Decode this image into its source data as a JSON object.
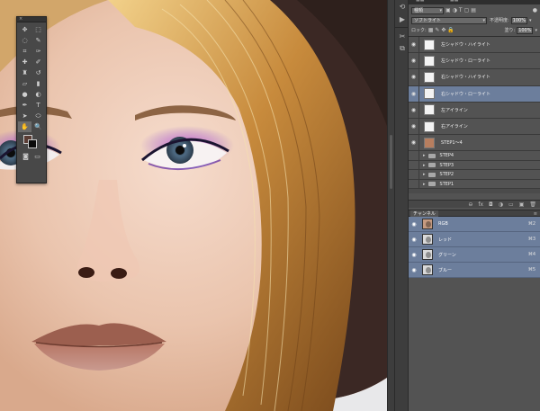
{
  "tools_panel": {
    "close_glyph": "×",
    "tools": [
      {
        "name": "move-icon",
        "glyph": "✥"
      },
      {
        "name": "marquee-icon",
        "glyph": "⬚"
      },
      {
        "name": "lasso-icon",
        "glyph": "◌"
      },
      {
        "name": "quick-select-icon",
        "glyph": "✎"
      },
      {
        "name": "crop-icon",
        "glyph": "⌗"
      },
      {
        "name": "eyedropper-icon",
        "glyph": "✑"
      },
      {
        "name": "healing-brush-icon",
        "glyph": "✚"
      },
      {
        "name": "brush-icon",
        "glyph": "✐"
      },
      {
        "name": "clone-stamp-icon",
        "glyph": "♜"
      },
      {
        "name": "history-brush-icon",
        "glyph": "↺"
      },
      {
        "name": "eraser-icon",
        "glyph": "▱"
      },
      {
        "name": "gradient-icon",
        "glyph": "▮"
      },
      {
        "name": "blur-icon",
        "glyph": "●"
      },
      {
        "name": "dodge-icon",
        "glyph": "◐"
      },
      {
        "name": "pen-icon",
        "glyph": "✒"
      },
      {
        "name": "type-icon",
        "glyph": "T"
      },
      {
        "name": "path-select-icon",
        "glyph": "➤"
      },
      {
        "name": "ellipse-shape-icon",
        "glyph": "⬭"
      },
      {
        "name": "hand-icon",
        "glyph": "✋"
      },
      {
        "name": "zoom-icon",
        "glyph": "🔍"
      }
    ],
    "colors": {
      "foreground": "#5a3c34",
      "background": "#0b0b0b"
    }
  },
  "layers_panel": {
    "filter_label": "種類",
    "blend_mode": "ソフトライト",
    "opacity_label": "不透明度:",
    "opacity_value": "100%",
    "lock_label": "ロック:",
    "fill_label": "塗り:",
    "fill_value": "100%",
    "layers": [
      {
        "name": "左シャドウ・ハイライト",
        "visible": true,
        "thumb": "white",
        "selected": false
      },
      {
        "name": "左シャドウ・ローライト",
        "visible": true,
        "thumb": "white",
        "selected": false
      },
      {
        "name": "右シャドウ・ハイライト",
        "visible": true,
        "thumb": "white",
        "selected": false
      },
      {
        "name": "右シャドウ・ローライト",
        "visible": true,
        "thumb": "white",
        "selected": true
      },
      {
        "name": "左アイライン",
        "visible": true,
        "thumb": "white",
        "selected": false
      },
      {
        "name": "右アイライン",
        "visible": true,
        "thumb": "white",
        "selected": false
      },
      {
        "name": "STEP1〜4",
        "visible": true,
        "thumb": "photo",
        "selected": false
      }
    ],
    "groups": [
      {
        "name": "STEP4"
      },
      {
        "name": "STEP3"
      },
      {
        "name": "STEP2"
      },
      {
        "name": "STEP1"
      }
    ]
  },
  "channels_panel": {
    "title": "チャンネル",
    "channels": [
      {
        "name": "RGB",
        "shortcut": "⌘2",
        "thumb": "rgb"
      },
      {
        "name": "レッド",
        "shortcut": "⌘3",
        "thumb": "gray"
      },
      {
        "name": "グリーン",
        "shortcut": "⌘4",
        "thumb": "gray"
      },
      {
        "name": "ブルー",
        "shortcut": "⌘5",
        "thumb": "gray"
      }
    ]
  }
}
